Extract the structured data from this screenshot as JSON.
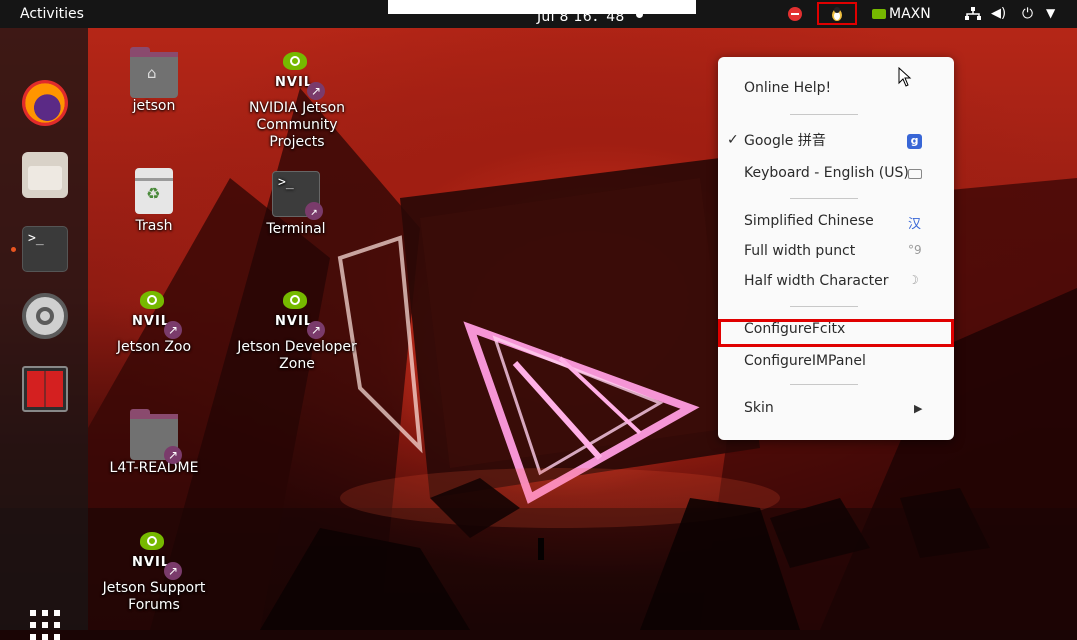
{
  "topbar": {
    "activities": "Activities",
    "clock": "Jul 8  16：48",
    "power_profile": "MAXN",
    "icons": [
      "stop-icon",
      "fcitx-tray-icon",
      "nvidia-icon",
      "network-icon",
      "volume-icon",
      "power-icon",
      "dropdown-arrow-icon"
    ]
  },
  "dock": {
    "items": [
      "firefox",
      "files",
      "terminal",
      "settings",
      "system-monitor",
      "show-applications"
    ]
  },
  "desktop": {
    "icons": [
      {
        "label": "jetson"
      },
      {
        "label": "NVIDIA Jetson Community Projects"
      },
      {
        "label": "Trash"
      },
      {
        "label": "Terminal"
      },
      {
        "label": "Jetson Zoo"
      },
      {
        "label": "Jetson Developer Zone"
      },
      {
        "label": "L4T-README"
      },
      {
        "label": "Jetson Support Forums"
      }
    ],
    "nvidia_word": "NVIL"
  },
  "menu": {
    "online_help": "Online Help!",
    "google_pinyin": "Google 拼音",
    "google_check": "✓",
    "google_badge": "g",
    "keyboard": "Keyboard - English (US)",
    "simplified_chinese": "Simplified Chinese",
    "simplified_chinese_glyph": "汉",
    "full_width": "Full width punct",
    "full_width_glyph": "°9",
    "half_width": "Half width Character",
    "half_width_glyph": "☽",
    "configure_fcitx": "ConfigureFcitx",
    "configure_impanel": "ConfigureIMPanel",
    "skin": "Skin",
    "skin_arrow": "▶"
  },
  "colors": {
    "highlight": "#e00000",
    "nvidia_green": "#76b900",
    "ubuntu_orange": "#e95420"
  }
}
